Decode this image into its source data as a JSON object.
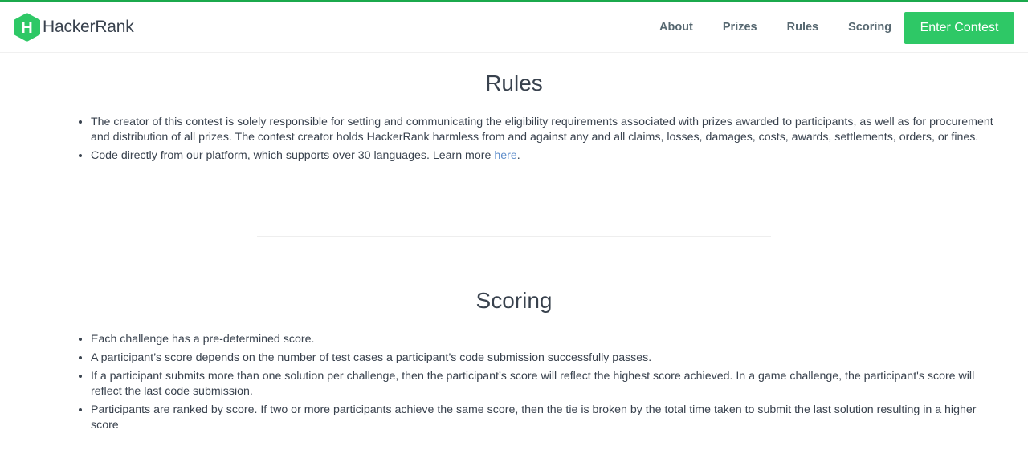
{
  "brand": {
    "name": "HackerRank",
    "logo_letter": "H",
    "color": "#1ba94c"
  },
  "nav": {
    "items": [
      "About",
      "Prizes",
      "Rules",
      "Scoring"
    ],
    "cta": "Enter Contest"
  },
  "rules": {
    "title": "Rules",
    "items": [
      "The creator of this contest is solely responsible for setting and communicating the eligibility requirements associated with prizes awarded to participants, as well as for procurement and distribution of all prizes. The contest creator holds HackerRank harmless from and against any and all claims, losses, damages, costs, awards, settlements, orders, or fines."
    ],
    "item2_prefix": "Code directly from our platform, which supports over 30 languages. Learn more ",
    "item2_link": "here",
    "item2_suffix": "."
  },
  "scoring": {
    "title": "Scoring",
    "items": [
      "Each challenge has a pre-determined score.",
      "A participant’s score depends on the number of test cases a participant’s code submission successfully passes.",
      "If a participant submits more than one solution per challenge, then the participant’s score will reflect the highest score achieved. In a game challenge, the participant's score will reflect the last code submission.",
      "Participants are ranked by score. If two or more participants achieve the same score, then the tie is broken by the total time taken to submit the last solution resulting in a higher score"
    ]
  }
}
